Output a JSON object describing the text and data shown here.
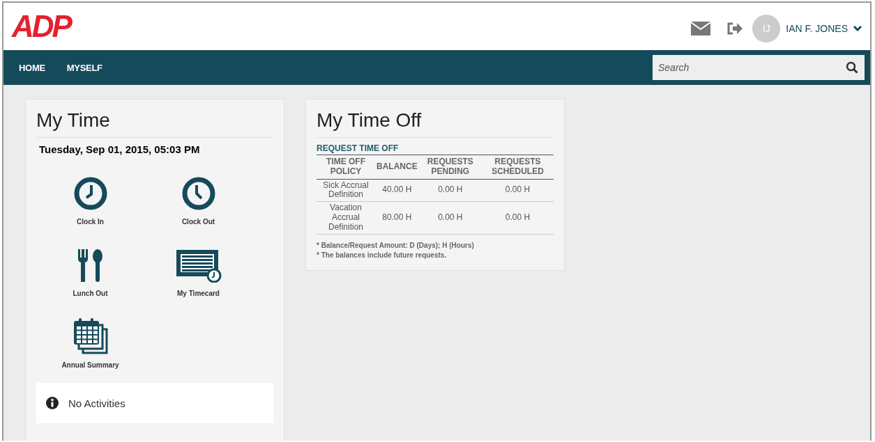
{
  "header": {
    "logo": "ADP",
    "user": {
      "initials": "IJ",
      "name": "IAN F. JONES"
    }
  },
  "nav": {
    "items": [
      {
        "label": "HOME"
      },
      {
        "label": "MYSELF"
      }
    ],
    "search": {
      "placeholder": "Search"
    }
  },
  "my_time": {
    "title": "My Time",
    "datetime": "Tuesday, Sep 01, 2015, 05:03 PM",
    "actions": [
      {
        "kind": "clock-in",
        "label": "Clock In"
      },
      {
        "kind": "clock-out",
        "label": "Clock Out"
      },
      {
        "kind": "lunch",
        "label": "Lunch Out"
      },
      {
        "kind": "timecard",
        "label": "My Timecard"
      },
      {
        "kind": "annual",
        "label": "Annual Summary"
      }
    ],
    "notice": "No Activities"
  },
  "my_time_off": {
    "title": "My Time Off",
    "link": "REQUEST TIME OFF",
    "table": {
      "columns": [
        "TIME OFF POLICY",
        "BALANCE",
        "REQUESTS PENDING",
        "REQUESTS SCHEDULED"
      ],
      "rows": [
        [
          "Sick Accrual Definition",
          "40.00 H",
          "0.00 H",
          "0.00 H"
        ],
        [
          "Vacation Accrual Definition",
          "80.00 H",
          "0.00 H",
          "0.00 H"
        ]
      ]
    },
    "notes": [
      "* Balance/Request Amount: D (Days); H (Hours)",
      "* The balances include future requests."
    ]
  }
}
